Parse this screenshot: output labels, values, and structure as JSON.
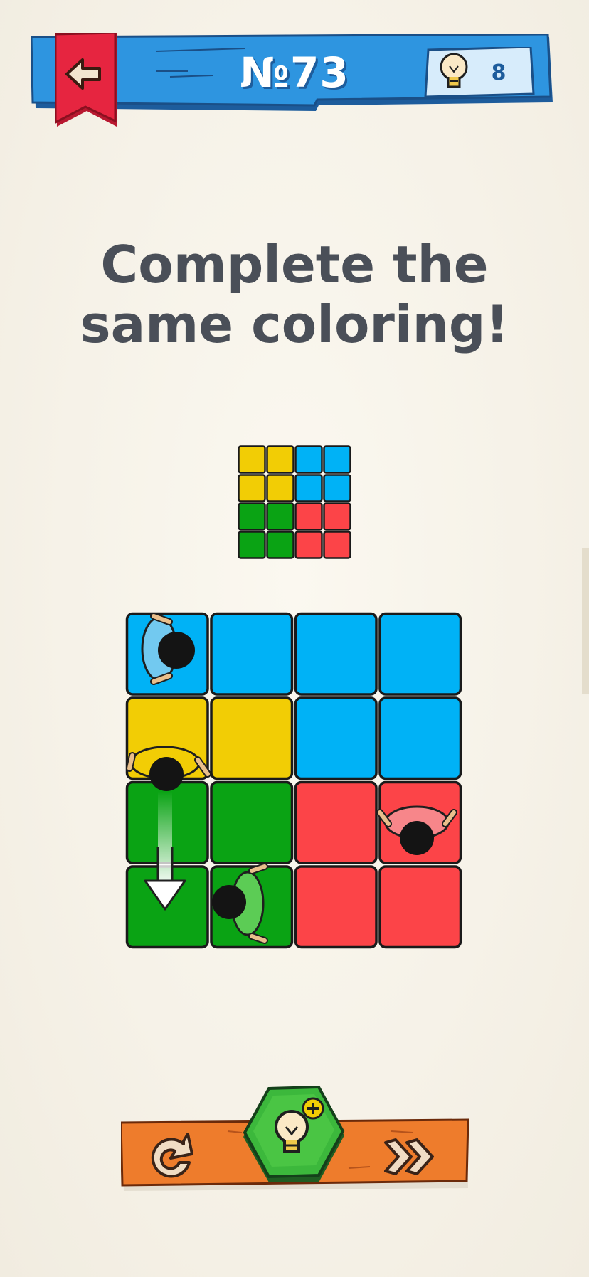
{
  "header": {
    "level_label": "№73",
    "hint_count": "8",
    "back_icon": "arrow-left-icon",
    "hint_icon": "lightbulb-icon"
  },
  "title": {
    "line1": "Complete the",
    "line2": "same coloring!"
  },
  "target_pattern": {
    "rows": [
      [
        "yellow",
        "yellow",
        "blue",
        "blue"
      ],
      [
        "yellow",
        "yellow",
        "blue",
        "blue"
      ],
      [
        "green",
        "green",
        "red",
        "red"
      ],
      [
        "green",
        "green",
        "red",
        "red"
      ]
    ]
  },
  "board": {
    "rows": [
      [
        "blue",
        "blue",
        "blue",
        "blue"
      ],
      [
        "yellow",
        "yellow",
        "blue",
        "blue"
      ],
      [
        "green",
        "green",
        "red",
        "red"
      ],
      [
        "green",
        "green",
        "red",
        "red"
      ]
    ],
    "characters": [
      "blue-character",
      "yellow-character",
      "red-character",
      "green-character"
    ],
    "hint_arrow": "down-arrow-icon"
  },
  "controls": {
    "restart_icon": "restart-icon",
    "hint_icon": "lightbulb-plus-icon",
    "skip_icon": "fast-forward-icon"
  },
  "colors": {
    "blue": "#00b2f6",
    "yellow": "#f2cd05",
    "green": "#0aa314",
    "red": "#fc4448",
    "header_blue": "#2e95e0",
    "ribbon_red": "#e62540",
    "bottom_orange": "#ee7c2c",
    "hex_green": "#3cb83c",
    "text_dark": "#4a4f58"
  }
}
